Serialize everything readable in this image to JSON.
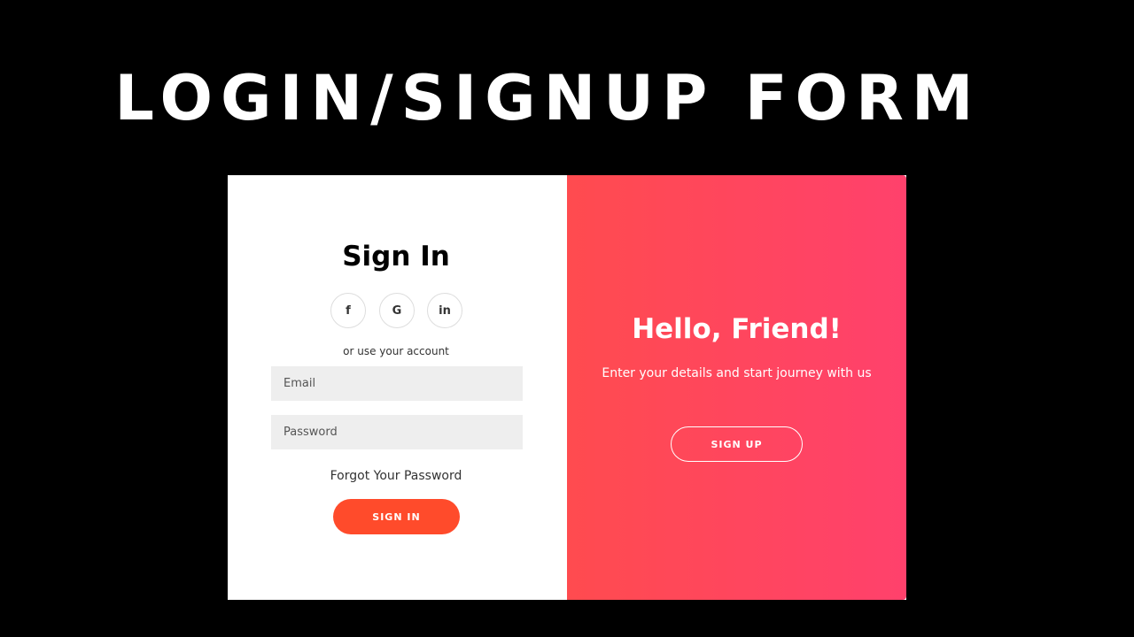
{
  "banner": {
    "title": "LOGIN/SIGNUP FORM"
  },
  "signin": {
    "title": "Sign In",
    "social": [
      {
        "label": "f",
        "icon": "facebook-icon"
      },
      {
        "label": "G",
        "icon": "google-icon"
      },
      {
        "label": "in",
        "icon": "linkedin-icon"
      }
    ],
    "alt_text": "or use your account",
    "email_placeholder": "Email",
    "password_placeholder": "Password",
    "forgot_label": "Forgot Your Password",
    "button_label": "SIGN IN"
  },
  "overlay": {
    "title": "Hello, Friend!",
    "text": "Enter your details and start journey with us",
    "button_label": "SIGN UP"
  },
  "colors": {
    "accent": "#ff4b2b",
    "gradient_start": "#ff4b4f",
    "gradient_end": "#ff416c",
    "background": "#000000",
    "input_bg": "#eeeeee"
  }
}
